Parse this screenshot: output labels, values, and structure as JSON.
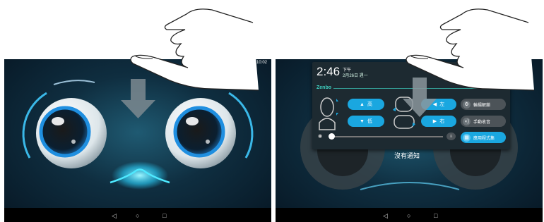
{
  "left_screen": {
    "status_time": "10:02",
    "nav": {
      "back": "◁",
      "home": "○",
      "recent": "□"
    }
  },
  "right_screen": {
    "time": "2:46",
    "ampm": "下午",
    "date": "2月26日 週一",
    "brand": "Zenbo",
    "controls": {
      "head_up": "高",
      "head_down": "低",
      "turn_left": "左",
      "turn_right": "右"
    },
    "toggles": [
      {
        "label": "輪揚解鎖",
        "icon": "⚙"
      },
      {
        "label": "手動收音",
        "icon": "◖)"
      },
      {
        "label": "應用程式集",
        "icon": "▦",
        "active": true
      }
    ],
    "volume_level": 0.02,
    "empty_message": "沒有通知",
    "nav": {
      "back": "◁",
      "home": "○",
      "recent": "□"
    }
  },
  "colors": {
    "accent": "#1aa7e0",
    "brand": "#3fd0c0",
    "glow": "#3ee6ff"
  }
}
